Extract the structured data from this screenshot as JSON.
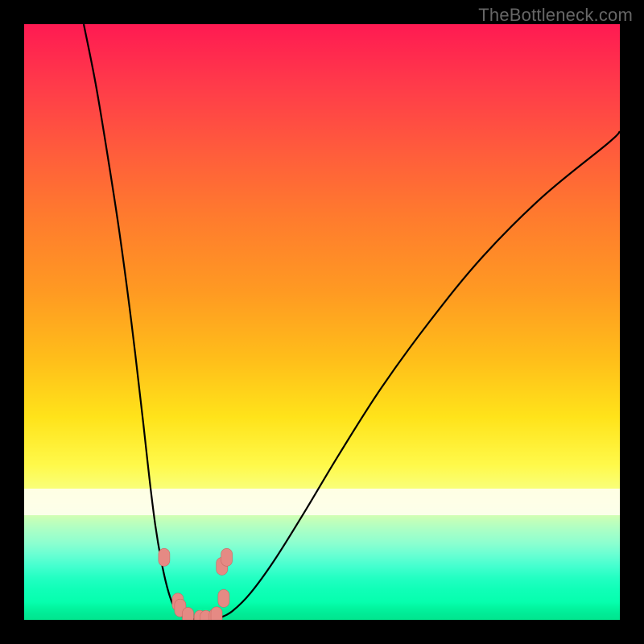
{
  "watermark": "TheBottleneck.com",
  "colors": {
    "page_bg": "#000000",
    "gradient_top": "#ff1a52",
    "gradient_mid": "#fff94a",
    "gradient_bottom": "#01e68e",
    "curve": "#000000",
    "marker_fill": "#e58a84",
    "marker_stroke": "#c96a63",
    "watermark": "#666666"
  },
  "chart_data": {
    "type": "line",
    "title": "",
    "xlabel": "",
    "ylabel": "",
    "xlim": [
      0,
      100
    ],
    "ylim": [
      0,
      100
    ],
    "note": "Axes are unlabeled; values are estimated pixel-space percentages. Curve is a V-shaped bottleneck profile. Low y = green (good), high y = red (bad).",
    "series": [
      {
        "name": "left-branch",
        "x": [
          10,
          12,
          14,
          16,
          18,
          20,
          21,
          22,
          23,
          24,
          25,
          26,
          27
        ],
        "y": [
          100,
          90,
          78,
          65,
          50,
          33,
          24,
          16,
          10,
          5.5,
          2.5,
          1.0,
          0.4
        ]
      },
      {
        "name": "valley",
        "x": [
          27,
          28,
          29,
          30,
          31,
          32,
          33
        ],
        "y": [
          0.4,
          0.15,
          0.05,
          0.02,
          0.05,
          0.15,
          0.4
        ]
      },
      {
        "name": "right-branch",
        "x": [
          33,
          35,
          38,
          42,
          47,
          53,
          60,
          68,
          77,
          87,
          98,
          100
        ],
        "y": [
          0.4,
          1.5,
          4.5,
          10,
          18,
          28,
          39,
          50,
          61,
          71,
          80,
          82
        ]
      }
    ],
    "markers": [
      {
        "x": 23.5,
        "y": 10.5
      },
      {
        "x": 25.8,
        "y": 3.0
      },
      {
        "x": 26.2,
        "y": 2.0
      },
      {
        "x": 27.5,
        "y": 0.6
      },
      {
        "x": 29.5,
        "y": 0.1
      },
      {
        "x": 30.5,
        "y": 0.1
      },
      {
        "x": 32.0,
        "y": 0.4
      },
      {
        "x": 32.3,
        "y": 0.7
      },
      {
        "x": 33.5,
        "y": 3.6
      },
      {
        "x": 33.2,
        "y": 9.0
      },
      {
        "x": 34.0,
        "y": 10.5
      }
    ]
  }
}
